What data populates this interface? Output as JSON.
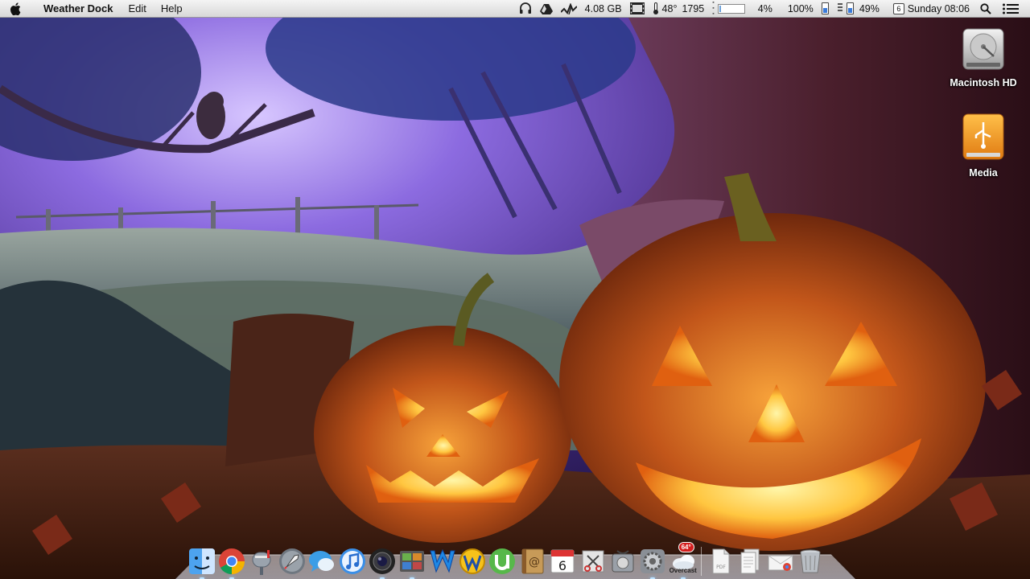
{
  "menubar": {
    "app_name": "Weather Dock",
    "menus": [
      "Edit",
      "Help"
    ],
    "status": {
      "disk_free": "4.08 GB",
      "weather_temp": "48°",
      "weather_value": "1795",
      "cpu_percent": "4%",
      "brightness_percent": "100%",
      "battery_percent": "49%",
      "calendar_day": "6",
      "clock": "Sunday 08:06"
    }
  },
  "desktop": {
    "icons": [
      {
        "label": "Macintosh HD",
        "icon": "hard-drive-icon"
      },
      {
        "label": "Media",
        "icon": "usb-drive-icon"
      }
    ]
  },
  "dock": {
    "apps": [
      {
        "name": "finder",
        "icon": "finder-icon"
      },
      {
        "name": "chrome",
        "icon": "chrome-icon"
      },
      {
        "name": "mail-stamp",
        "icon": "mailbox-icon"
      },
      {
        "name": "launchpad",
        "icon": "rocket-icon"
      },
      {
        "name": "messages",
        "icon": "chat-bubbles-icon"
      },
      {
        "name": "itunes",
        "icon": "music-icon"
      },
      {
        "name": "photo-booth",
        "icon": "camera-lens-icon"
      },
      {
        "name": "preview",
        "icon": "photos-icon"
      },
      {
        "name": "wordpress",
        "icon": "w-letter-icon"
      },
      {
        "name": "feed-reader",
        "icon": "w-stamp-icon"
      },
      {
        "name": "utorrent",
        "icon": "utorrent-icon"
      },
      {
        "name": "address-book",
        "icon": "contacts-icon"
      },
      {
        "name": "calendar",
        "icon": "calendar-icon"
      },
      {
        "name": "scissors",
        "icon": "scissors-icon"
      },
      {
        "name": "utilities",
        "icon": "disk-utility-icon"
      },
      {
        "name": "system-preferences",
        "icon": "gears-icon"
      },
      {
        "name": "weather",
        "icon": "cloud-icon"
      }
    ],
    "calendar_day": "6",
    "weather_badge": "64°",
    "weather_label": "Overcast",
    "stacks": [
      {
        "name": "pdf-stack",
        "icon": "pdf-icon"
      },
      {
        "name": "documents-stack",
        "icon": "documents-icon"
      },
      {
        "name": "downloads-stack",
        "icon": "downloads-icon"
      },
      {
        "name": "trash",
        "icon": "trash-icon"
      }
    ],
    "pdf_label": "PDF"
  },
  "colors": {
    "menubar_top": "#f4f4f4",
    "menubar_bottom": "#d8d8d8",
    "sky": "#5a3f9e",
    "pumpkin": "#e07a18",
    "glow": "#ffd34a"
  }
}
